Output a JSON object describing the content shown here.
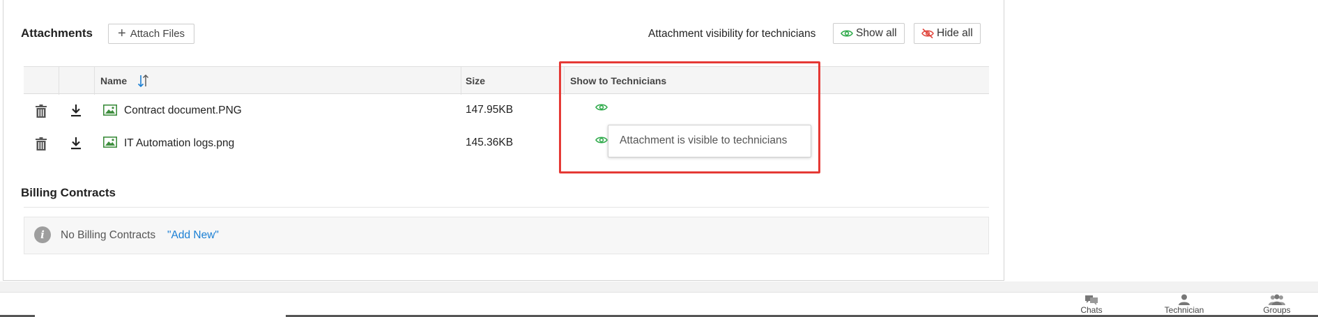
{
  "attachments": {
    "title": "Attachments",
    "attach_button": "Attach Files",
    "visibility_label": "Attachment visibility for technicians",
    "show_all": "Show all",
    "hide_all": "Hide all",
    "columns": {
      "name": "Name",
      "size": "Size",
      "show_to_technicians": "Show to Technicians"
    },
    "rows": [
      {
        "name": "Contract document.PNG",
        "size": "147.95KB"
      },
      {
        "name": "IT Automation logs.png",
        "size": "145.36KB"
      }
    ],
    "tooltip": "Attachment is visible to technicians"
  },
  "billing": {
    "title": "Billing Contracts",
    "empty_text": "No Billing Contracts",
    "add_new": "\"Add New\""
  },
  "bottom_nav": {
    "chats": "Chats",
    "technician": "Technician",
    "groups": "Groups"
  },
  "colors": {
    "accent_green": "#2eaa4a",
    "link_blue": "#1a7fd4",
    "highlight_red": "#e53935",
    "hide_red": "#e0453c"
  }
}
